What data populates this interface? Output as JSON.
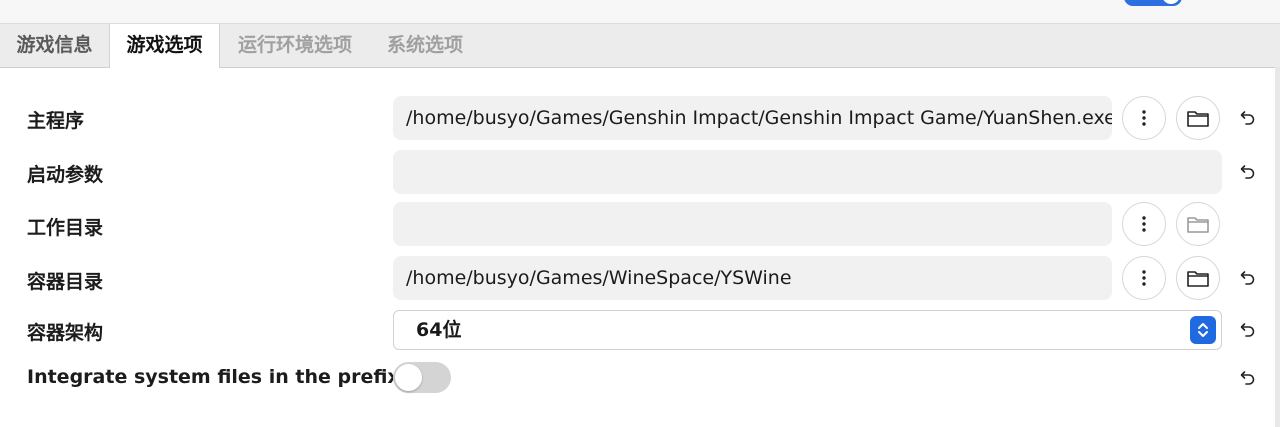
{
  "tabs": [
    {
      "label": "游戏信息",
      "state": "normal"
    },
    {
      "label": "游戏选项",
      "state": "active"
    },
    {
      "label": "运行环境选项",
      "state": "disabled"
    },
    {
      "label": "系统选项",
      "state": "disabled"
    }
  ],
  "rows": {
    "executable": {
      "label": "主程序",
      "value": "/home/busyo/Games/Genshin Impact/Genshin Impact Game/YuanShen.exe"
    },
    "arguments": {
      "label": "启动参数",
      "value": ""
    },
    "working_dir": {
      "label": "工作目录",
      "value": ""
    },
    "prefix_dir": {
      "label": "容器目录",
      "value": "/home/busyo/Games/WineSpace/YSWine"
    },
    "prefix_arch": {
      "label": "容器架构",
      "value": "64位"
    },
    "integrate": {
      "label": "Integrate system files in the prefix",
      "enabled": false
    }
  },
  "icons": {
    "more": "more-vertical-icon",
    "browse": "folder-icon",
    "reset": "undo-icon",
    "stepper": "chevron-up-down-icon"
  },
  "colors": {
    "accent": "#1f6ae0",
    "field_bg": "#f1f1f1",
    "tab_bar_bg": "#ececec",
    "switch_off": "#d4d4d4"
  }
}
